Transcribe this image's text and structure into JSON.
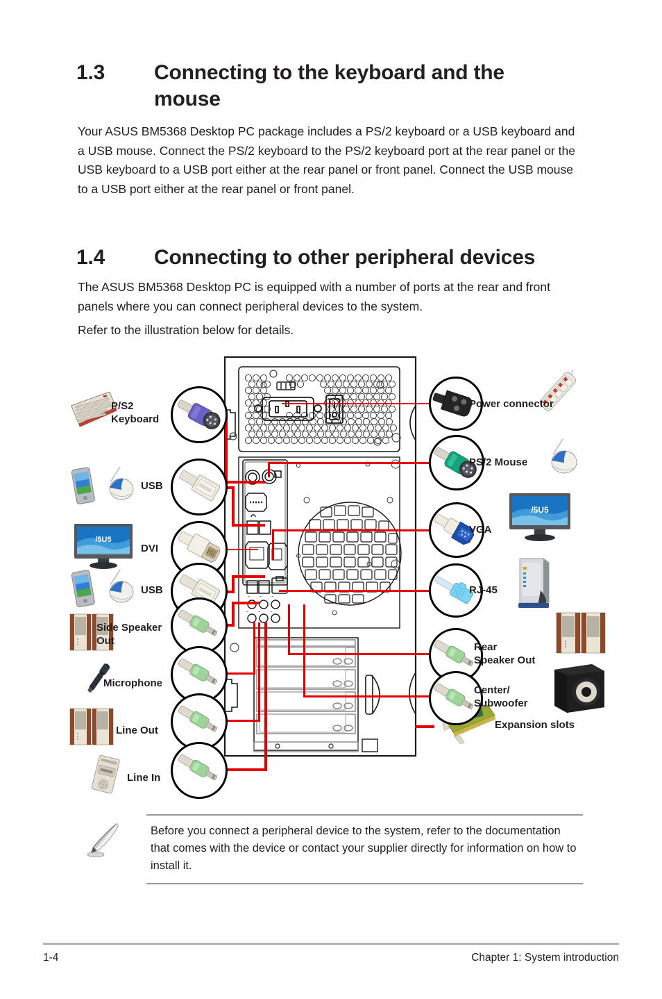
{
  "document": {
    "sections": [
      {
        "number": "1.3",
        "title": "Connecting to the keyboard and the mouse",
        "paragraphs": [
          "Your ASUS BM5368 Desktop PC package includes a PS/2 keyboard or a USB keyboard and a USB mouse. Connect the PS/2 keyboard to the PS/2 keyboard port at the rear panel or the USB keyboard to a USB port either at the rear panel or front panel. Connect the USB mouse to a USB port either at the rear panel or front panel."
        ]
      },
      {
        "number": "1.4",
        "title": "Connecting to other peripheral devices",
        "paragraphs": [
          "The ASUS BM5368 Desktop PC is equipped with a number of ports at the rear and front panels where you can connect peripheral devices to the system.",
          "Refer to the illustration below for details."
        ]
      }
    ],
    "note": {
      "icon": "note-pen-icon",
      "text": "Before you connect a peripheral device to the system, refer to the documentation that comes with the device or contact your supplier directly for information on how to install it."
    },
    "footer": {
      "page_number": "1-4",
      "chapter": "Chapter 1: System introduction"
    }
  },
  "diagram": {
    "title": "Rear panel connection diagram",
    "accent_color": "#e60000",
    "left_callouts": [
      {
        "label": "P/S2\nKeyboard",
        "connector": "ps2-keyboard-connector",
        "color": "#6b5fc4",
        "device": "keyboard"
      },
      {
        "label": "USB",
        "connector": "usb-type-a-connector",
        "color": "#e8e4d8",
        "device": "pda-and-mouse"
      },
      {
        "label": "DVI",
        "connector": "dvi-connector",
        "color": "#efeade",
        "device": "lcd-monitor"
      },
      {
        "label": "USB",
        "connector": "usb-type-a-connector",
        "color": "#e8e4d8",
        "device": "pda-and-mouse"
      },
      {
        "label": "Side Speaker\nOut",
        "connector": "audio-jack-green",
        "color": "#9ed49a",
        "device": "speakers"
      },
      {
        "label": "Microphone",
        "connector": "audio-jack-green",
        "color": "#9ed49a",
        "device": "microphone"
      },
      {
        "label": "Line Out",
        "connector": "audio-jack-green",
        "color": "#9ed49a",
        "device": "speakers"
      },
      {
        "label": "Line In",
        "connector": "audio-jack-green",
        "color": "#9ed49a",
        "device": "cassette-player"
      }
    ],
    "right_callouts": [
      {
        "label": "Power connector",
        "connector": "iec-power-connector",
        "color": "#2b2b2b",
        "device": "power-strip"
      },
      {
        "label": "PS/2 Mouse",
        "connector": "ps2-mouse-connector",
        "color": "#11a37b",
        "device": "mouse"
      },
      {
        "label": "VGA",
        "connector": "vga-connector",
        "color": "#1b4fae",
        "device": "lcd-monitor"
      },
      {
        "label": "RJ-45",
        "connector": "rj45-connector",
        "color": "#7fd3f2",
        "device": "router"
      },
      {
        "label": "Rear\nSpeaker Out",
        "connector": "audio-jack-green",
        "color": "#9ed49a",
        "device": "speakers"
      },
      {
        "label": "Center/\nSubwoofer",
        "connector": "audio-jack-green",
        "color": "#9ed49a",
        "device": "subwoofer"
      },
      {
        "label": "Expansion slots",
        "connector": "none",
        "color": "#c8a828",
        "device": "expansion-card"
      }
    ]
  }
}
